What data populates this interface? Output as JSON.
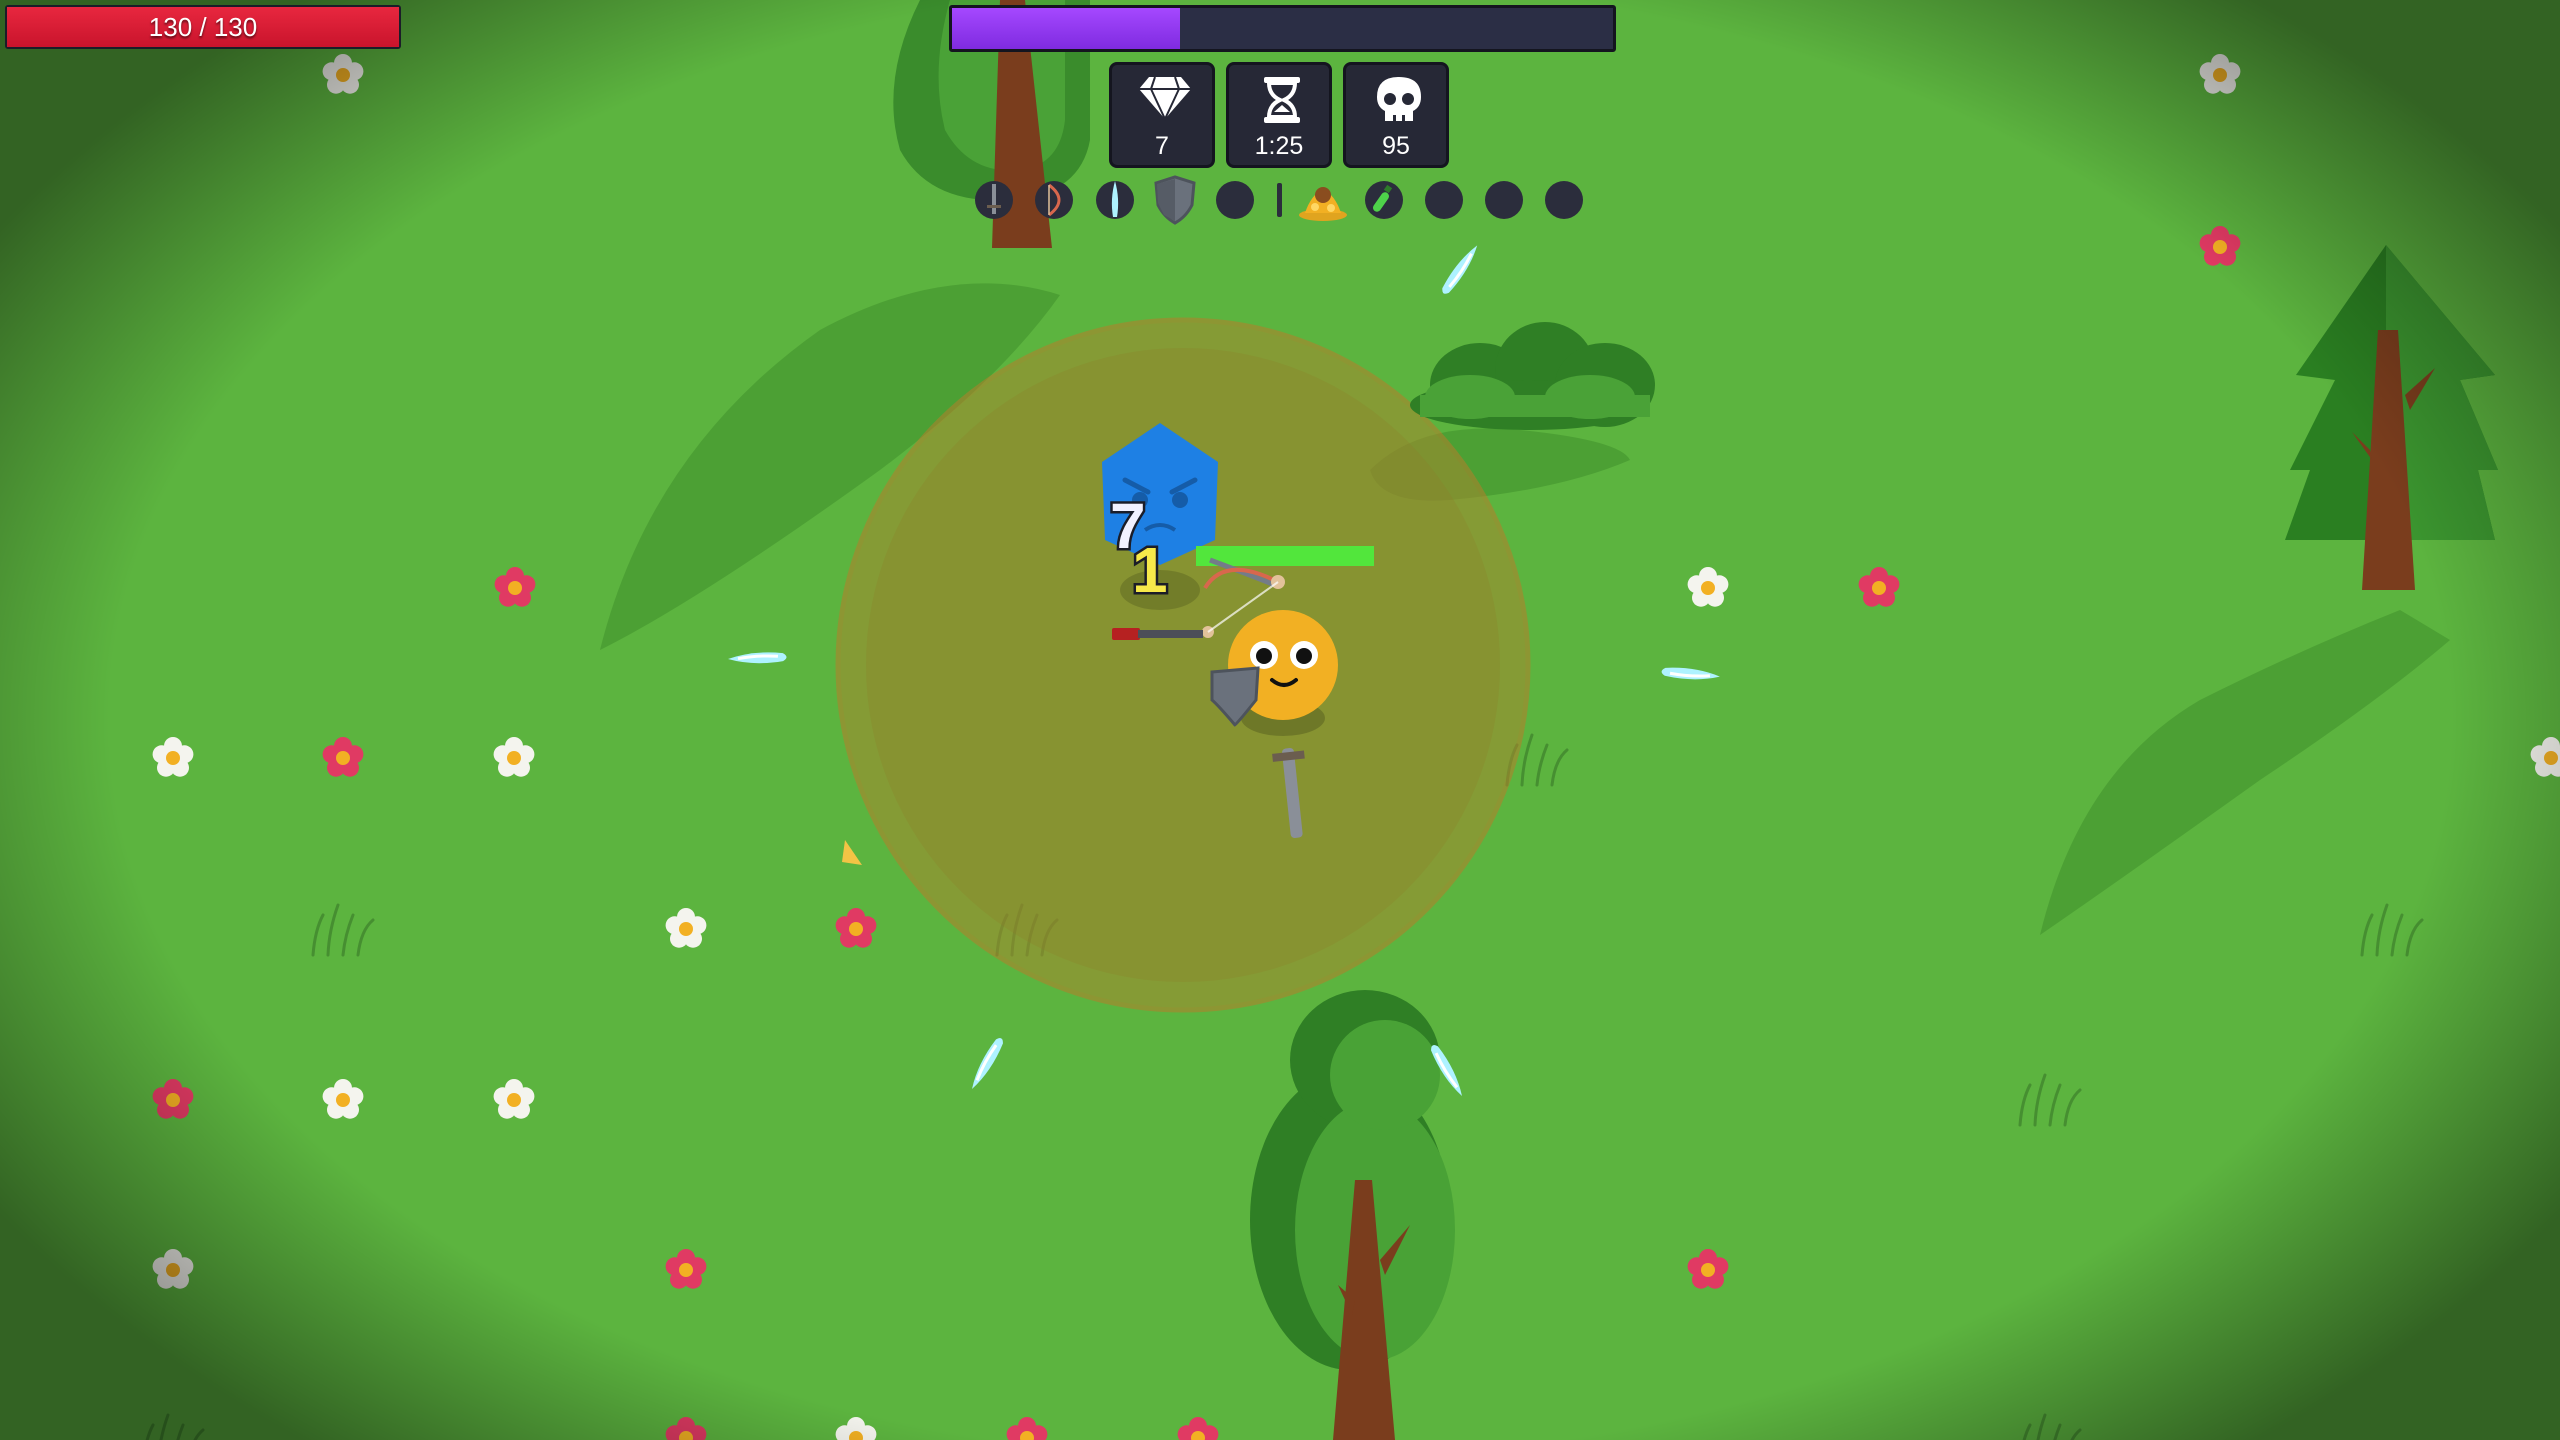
{
  "hud": {
    "health": {
      "current": 130,
      "max": 130,
      "label": "130 / 130",
      "fraction": 1.0
    },
    "experience": {
      "fraction": 0.345
    },
    "stats": {
      "gems": "7",
      "time": "1:25",
      "kills": "95"
    },
    "weapon_slots": [
      {
        "name": "sword-icon",
        "filled": true
      },
      {
        "name": "bow-icon",
        "filled": true
      },
      {
        "name": "ice-shard-icon",
        "filled": true
      },
      {
        "name": "shield-icon",
        "filled": true
      },
      {
        "name": "empty",
        "filled": false
      }
    ],
    "passive_slots": [
      {
        "name": "gold-pile-icon",
        "filled": true
      },
      {
        "name": "potion-icon",
        "filled": true
      },
      {
        "name": "empty",
        "filled": false
      },
      {
        "name": "empty",
        "filled": false
      },
      {
        "name": "empty",
        "filled": false
      }
    ]
  },
  "colors": {
    "grass": "#5cb43f",
    "health": "#e0203a",
    "experience": "#9238f5",
    "aura": "#b57f2a",
    "player": "#f2b023",
    "enemy": "#1f7fe0"
  }
}
